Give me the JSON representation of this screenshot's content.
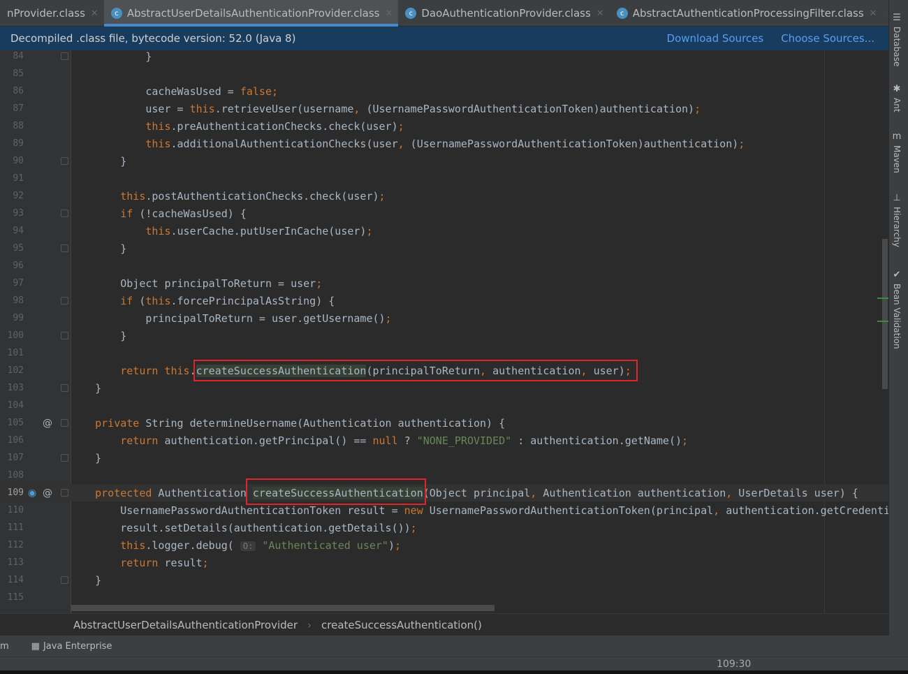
{
  "tabs": [
    {
      "label": "nProvider.class",
      "active": false
    },
    {
      "label": "AbstractUserDetailsAuthenticationProvider.class",
      "active": true
    },
    {
      "label": "DaoAuthenticationProvider.class",
      "active": false
    },
    {
      "label": "AbstractAuthenticationProcessingFilter.class",
      "active": false
    }
  ],
  "tab_overflow": "▾≡3",
  "banner": {
    "text": "Decompiled .class file, bytecode version: 52.0 (Java 8)",
    "download": "Download Sources",
    "choose": "Choose Sources..."
  },
  "colors": {
    "keyword": "#cc7832",
    "string": "#6a8759",
    "text": "#a9b7c6",
    "highlight_box": "#e0242b",
    "background": "#2b2b2b"
  },
  "lines": [
    {
      "n": "84",
      "t": [
        [
          "t",
          "            }"
        ]
      ]
    },
    {
      "n": "85",
      "t": []
    },
    {
      "n": "86",
      "t": [
        [
          "t",
          "            cacheWasUsed = "
        ],
        [
          "k",
          "false"
        ],
        [
          "p",
          ";"
        ]
      ]
    },
    {
      "n": "87",
      "t": [
        [
          "t",
          "            user = "
        ],
        [
          "k",
          "this"
        ],
        [
          "t",
          ".retrieveUser(username"
        ],
        [
          "p",
          ","
        ],
        [
          "t",
          " (UsernamePasswordAuthenticationToken)authentication)"
        ],
        [
          "p",
          ";"
        ]
      ]
    },
    {
      "n": "88",
      "t": [
        [
          "t",
          "            "
        ],
        [
          "k",
          "this"
        ],
        [
          "t",
          ".preAuthenticationChecks.check(user)"
        ],
        [
          "p",
          ";"
        ]
      ]
    },
    {
      "n": "89",
      "t": [
        [
          "t",
          "            "
        ],
        [
          "k",
          "this"
        ],
        [
          "t",
          ".additionalAuthenticationChecks(user"
        ],
        [
          "p",
          ","
        ],
        [
          "t",
          " (UsernamePasswordAuthenticationToken)authentication)"
        ],
        [
          "p",
          ";"
        ]
      ]
    },
    {
      "n": "90",
      "t": [
        [
          "t",
          "        }"
        ]
      ]
    },
    {
      "n": "91",
      "t": []
    },
    {
      "n": "92",
      "t": [
        [
          "t",
          "        "
        ],
        [
          "k",
          "this"
        ],
        [
          "t",
          ".postAuthenticationChecks.check(user)"
        ],
        [
          "p",
          ";"
        ]
      ]
    },
    {
      "n": "93",
      "t": [
        [
          "t",
          "        "
        ],
        [
          "k",
          "if"
        ],
        [
          "t",
          " (!cacheWasUsed) {"
        ]
      ]
    },
    {
      "n": "94",
      "t": [
        [
          "t",
          "            "
        ],
        [
          "k",
          "this"
        ],
        [
          "t",
          ".userCache.putUserInCache(user)"
        ],
        [
          "p",
          ";"
        ]
      ]
    },
    {
      "n": "95",
      "t": [
        [
          "t",
          "        }"
        ]
      ]
    },
    {
      "n": "96",
      "t": []
    },
    {
      "n": "97",
      "t": [
        [
          "t",
          "        Object principalToReturn = user"
        ],
        [
          "p",
          ";"
        ]
      ]
    },
    {
      "n": "98",
      "t": [
        [
          "t",
          "        "
        ],
        [
          "k",
          "if"
        ],
        [
          "t",
          " ("
        ],
        [
          "k",
          "this"
        ],
        [
          "t",
          ".forcePrincipalAsString) {"
        ]
      ]
    },
    {
      "n": "99",
      "t": [
        [
          "t",
          "            principalToReturn = user.getUsername()"
        ],
        [
          "p",
          ";"
        ]
      ]
    },
    {
      "n": "100",
      "t": [
        [
          "t",
          "        }"
        ]
      ]
    },
    {
      "n": "101",
      "t": []
    },
    {
      "n": "102",
      "t": [
        [
          "t",
          "        "
        ],
        [
          "k",
          "return this"
        ],
        [
          "t",
          "."
        ],
        [
          "h",
          "createSuccessAuthentication"
        ],
        [
          "t",
          "(principalToReturn"
        ],
        [
          "p",
          ","
        ],
        [
          "t",
          " authentication"
        ],
        [
          "p",
          ","
        ],
        [
          "t",
          " user)"
        ],
        [
          "p",
          ";"
        ]
      ]
    },
    {
      "n": "103",
      "t": [
        [
          "t",
          "    }"
        ]
      ]
    },
    {
      "n": "104",
      "t": []
    },
    {
      "n": "105",
      "t": [
        [
          "t",
          "    "
        ],
        [
          "k",
          "private"
        ],
        [
          "t",
          " String determineUsername(Authentication authentication) {"
        ]
      ]
    },
    {
      "n": "106",
      "t": [
        [
          "t",
          "        "
        ],
        [
          "k",
          "return"
        ],
        [
          "t",
          " authentication.getPrincipal() == "
        ],
        [
          "k",
          "null"
        ],
        [
          "t",
          " ? "
        ],
        [
          "s",
          "\"NONE_PROVIDED\""
        ],
        [
          "t",
          " : authentication.getName()"
        ],
        [
          "p",
          ";"
        ]
      ]
    },
    {
      "n": "107",
      "t": [
        [
          "t",
          "    }"
        ]
      ]
    },
    {
      "n": "108",
      "t": []
    },
    {
      "n": "109",
      "t": [
        [
          "t",
          "    "
        ],
        [
          "k",
          "protected"
        ],
        [
          "t",
          " Authentication "
        ],
        [
          "h",
          "createSuccessAuthentication"
        ],
        [
          "t",
          "(Object principal"
        ],
        [
          "p",
          ","
        ],
        [
          "t",
          " Authentication authentication"
        ],
        [
          "p",
          ","
        ],
        [
          "t",
          " UserDetails user) {"
        ]
      ]
    },
    {
      "n": "110",
      "t": [
        [
          "t",
          "        UsernamePasswordAuthenticationToken result = "
        ],
        [
          "k",
          "new"
        ],
        [
          "t",
          " UsernamePasswordAuthenticationToken(principal"
        ],
        [
          "p",
          ","
        ],
        [
          "t",
          " authentication.getCredenti"
        ]
      ]
    },
    {
      "n": "111",
      "t": [
        [
          "t",
          "        result.setDetails(authentication.getDetails())"
        ],
        [
          "p",
          ";"
        ]
      ]
    },
    {
      "n": "112",
      "t": [
        [
          "t",
          "        "
        ],
        [
          "k",
          "this"
        ],
        [
          "t",
          ".logger.debug( "
        ],
        [
          "hint",
          "O:"
        ],
        [
          "t",
          " "
        ],
        [
          "s",
          "\"Authenticated user\""
        ],
        [
          "t",
          ")"
        ],
        [
          "p",
          ";"
        ]
      ]
    },
    {
      "n": "113",
      "t": [
        [
          "t",
          "        "
        ],
        [
          "k",
          "return"
        ],
        [
          "t",
          " result"
        ],
        [
          "p",
          ";"
        ]
      ]
    },
    {
      "n": "114",
      "t": [
        [
          "t",
          "    }"
        ]
      ]
    },
    {
      "n": "115",
      "t": []
    }
  ],
  "breadcrumb": {
    "class": "AbstractUserDetailsAuthenticationProvider",
    "method": "createSuccessAuthentication()"
  },
  "toolbar": {
    "left": "m",
    "java_enterprise": "Java Enterprise"
  },
  "status": {
    "position": "109:30"
  },
  "side_tools": [
    {
      "label": "Database",
      "icon": "database-icon"
    },
    {
      "label": "Ant",
      "icon": "ant-icon"
    },
    {
      "label": "Maven",
      "icon": "maven-icon"
    },
    {
      "label": "Hierarchy",
      "icon": "hierarchy-icon"
    },
    {
      "label": "Bean Validation",
      "icon": "bean-validation-icon"
    }
  ]
}
